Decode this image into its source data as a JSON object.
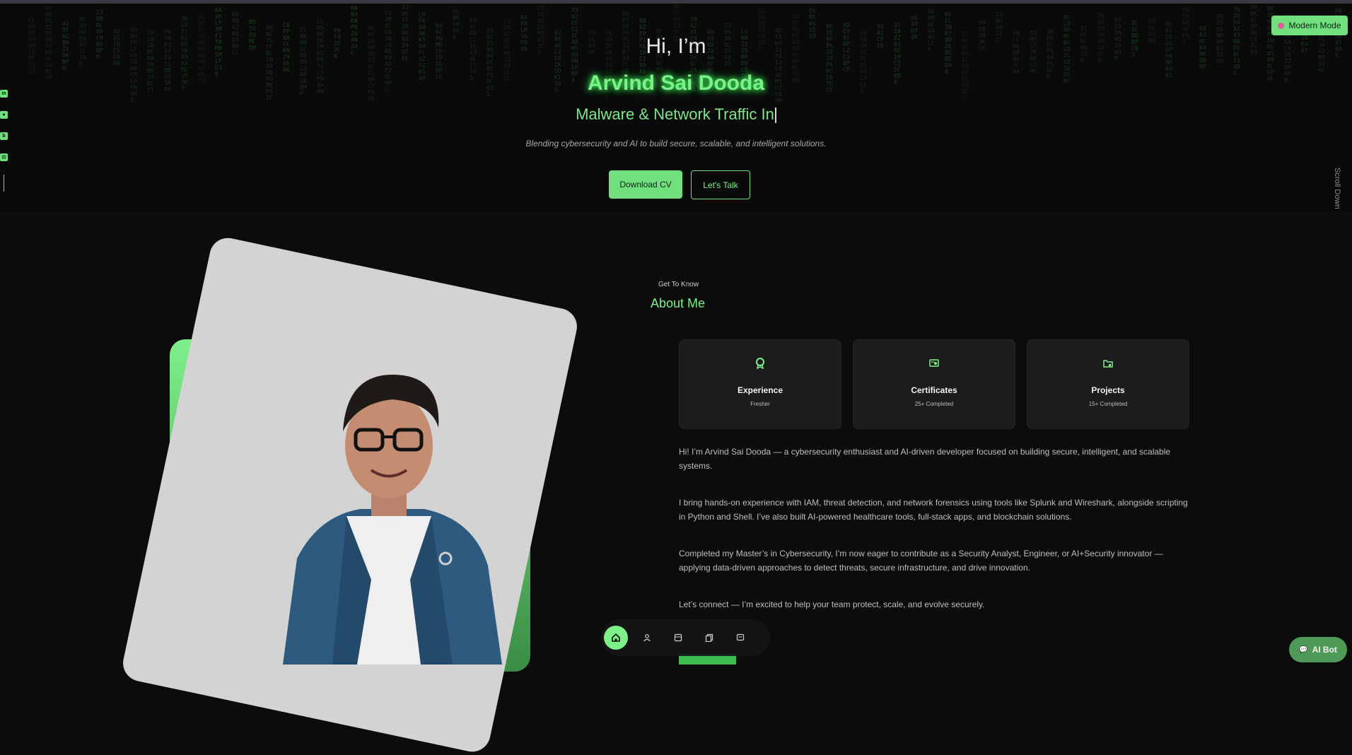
{
  "hero": {
    "greeting": "Hi, I’m",
    "name": "Arvind Sai Dooda",
    "typed_role": "Malware & Network Traffic In",
    "tagline": "Blending cybersecurity and AI to build secure, scalable, and intelligent solutions.",
    "download_cv_label": "Download CV",
    "lets_talk_label": "Let's Talk",
    "scroll_down_label": "Scroll Down"
  },
  "header": {
    "mode_toggle_label": "Modern Mode"
  },
  "social_icons": [
    "linkedin-icon",
    "github-icon",
    "blog-icon",
    "portfolio-icon"
  ],
  "about": {
    "eyebrow": "Get To Know",
    "title": "About Me",
    "cards": [
      {
        "icon": "award-icon",
        "title": "Experience",
        "subtitle": "Fresher"
      },
      {
        "icon": "certificate-icon",
        "title": "Certificates",
        "subtitle": "25+ Completed"
      },
      {
        "icon": "folder-icon",
        "title": "Projects",
        "subtitle": "15+ Completed"
      }
    ],
    "paragraphs": [
      "Hi! I’m Arvind Sai Dooda — a cybersecurity enthusiast and AI-driven developer focused on building secure, intelligent, and scalable systems.",
      "I bring hands-on experience with IAM, threat detection, and network forensics using tools like Splunk and Wireshark, alongside scripting in Python and Shell. I’ve also built AI-powered healthcare tools, full-stack apps, and blockchain solutions.",
      "Completed my Master’s in Cybersecurity, I’m now eager to contribute as a Security Analyst, Engineer, or AI+Security innovator — applying data-driven approaches to detect threats, secure infrastructure, and drive innovation.",
      "Let’s connect — I’m excited to help your team protect, scale, and evolve securely."
    ]
  },
  "bottom_nav": {
    "items": [
      "home-icon",
      "user-icon",
      "book-icon",
      "copy-icon",
      "message-icon"
    ],
    "active_index": 0
  },
  "ai_bot_label": "AI Bot",
  "colors": {
    "accent": "#7ef08a",
    "background": "#0c0c0c",
    "card": "#1c1c1c"
  }
}
